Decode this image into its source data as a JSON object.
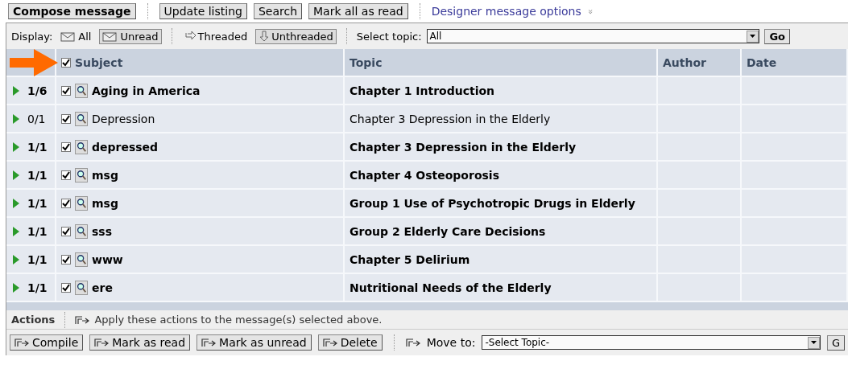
{
  "toolbar": {
    "buttons": [
      "Compose message",
      "Update listing",
      "Search",
      "Mark all as read"
    ],
    "options_link": "Designer message options",
    "options_caret": "»"
  },
  "display": {
    "label": "Display:",
    "filters": [
      {
        "label": "All",
        "selected": false
      },
      {
        "label": "Unread",
        "selected": true
      }
    ],
    "views": [
      {
        "label": "Threaded",
        "selected": false
      },
      {
        "label": "Unthreaded",
        "selected": true
      }
    ],
    "topic_label": "Select topic:",
    "topic_value": "All",
    "go": "Go"
  },
  "table": {
    "columns": [
      "Subject",
      "Topic",
      "Author",
      "Date"
    ],
    "select_all_checked": true,
    "rows": [
      {
        "count": "1/6",
        "checked": true,
        "subject": "Aging in America",
        "topic": "Chapter 1 Introduction",
        "unread": true
      },
      {
        "count": "0/1",
        "checked": true,
        "subject": "Depression",
        "topic": "Chapter 3 Depression in the Elderly",
        "unread": false
      },
      {
        "count": "1/1",
        "checked": true,
        "subject": "depressed",
        "topic": "Chapter 3 Depression in the Elderly",
        "unread": true
      },
      {
        "count": "1/1",
        "checked": true,
        "subject": "msg",
        "topic": "Chapter 4 Osteoporosis",
        "unread": true
      },
      {
        "count": "1/1",
        "checked": true,
        "subject": "msg",
        "topic": "Group 1 Use of Psychotropic Drugs in Elderly",
        "unread": true
      },
      {
        "count": "1/1",
        "checked": true,
        "subject": "sss",
        "topic": "Group 2 Elderly Care Decisions",
        "unread": true
      },
      {
        "count": "1/1",
        "checked": true,
        "subject": "www",
        "topic": "Chapter 5 Delirium",
        "unread": true
      },
      {
        "count": "1/1",
        "checked": true,
        "subject": "ere",
        "topic": "Nutritional Needs of the Elderly",
        "unread": true
      }
    ]
  },
  "actions": {
    "label": "Actions",
    "hint": "Apply these actions to the message(s) selected above.",
    "buttons": [
      "Compile",
      "Mark as read",
      "Mark as unread",
      "Delete"
    ],
    "move_label": "Move to:",
    "move_value": "-Select Topic-",
    "go": "G"
  }
}
